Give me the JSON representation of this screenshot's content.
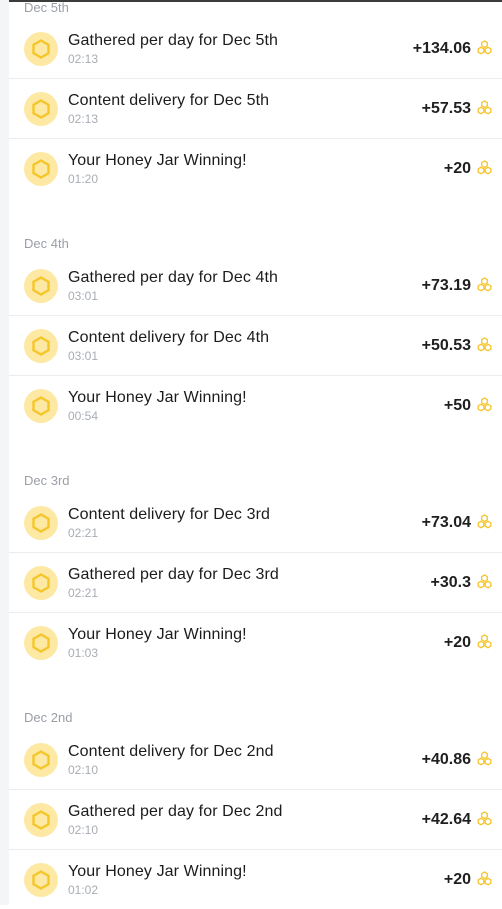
{
  "colors": {
    "accent": "#f5c62b",
    "coin_bg": "#fde9a4"
  },
  "groups": [
    {
      "date": "Dec 5th",
      "items": [
        {
          "title": "Gathered per day for Dec 5th",
          "time": "02:13",
          "amount": "+134.06",
          "icon": "hexagon-coin-icon"
        },
        {
          "title": "Content delivery for Dec 5th",
          "time": "02:13",
          "amount": "+57.53",
          "icon": "hexagon-coin-icon"
        },
        {
          "title": "Your Honey Jar Winning!",
          "time": "01:20",
          "amount": "+20",
          "icon": "hexagon-coin-icon"
        }
      ]
    },
    {
      "date": "Dec 4th",
      "items": [
        {
          "title": "Gathered per day for Dec 4th",
          "time": "03:01",
          "amount": "+73.19",
          "icon": "hexagon-coin-icon"
        },
        {
          "title": "Content delivery for Dec 4th",
          "time": "03:01",
          "amount": "+50.53",
          "icon": "hexagon-coin-icon"
        },
        {
          "title": "Your Honey Jar Winning!",
          "time": "00:54",
          "amount": "+50",
          "icon": "hexagon-coin-icon"
        }
      ]
    },
    {
      "date": "Dec 3rd",
      "items": [
        {
          "title": "Content delivery for Dec 3rd",
          "time": "02:21",
          "amount": "+73.04",
          "icon": "hexagon-coin-icon"
        },
        {
          "title": "Gathered per day for Dec 3rd",
          "time": "02:21",
          "amount": "+30.3",
          "icon": "hexagon-coin-icon"
        },
        {
          "title": "Your Honey Jar Winning!",
          "time": "01:03",
          "amount": "+20",
          "icon": "hexagon-coin-icon"
        }
      ]
    },
    {
      "date": "Dec 2nd",
      "items": [
        {
          "title": "Content delivery for Dec 2nd",
          "time": "02:10",
          "amount": "+40.86",
          "icon": "hexagon-coin-icon"
        },
        {
          "title": "Gathered per day for Dec 2nd",
          "time": "02:10",
          "amount": "+42.64",
          "icon": "hexagon-coin-icon"
        },
        {
          "title": "Your Honey Jar Winning!",
          "time": "01:02",
          "amount": "+20",
          "icon": "hexagon-coin-icon"
        }
      ]
    }
  ]
}
